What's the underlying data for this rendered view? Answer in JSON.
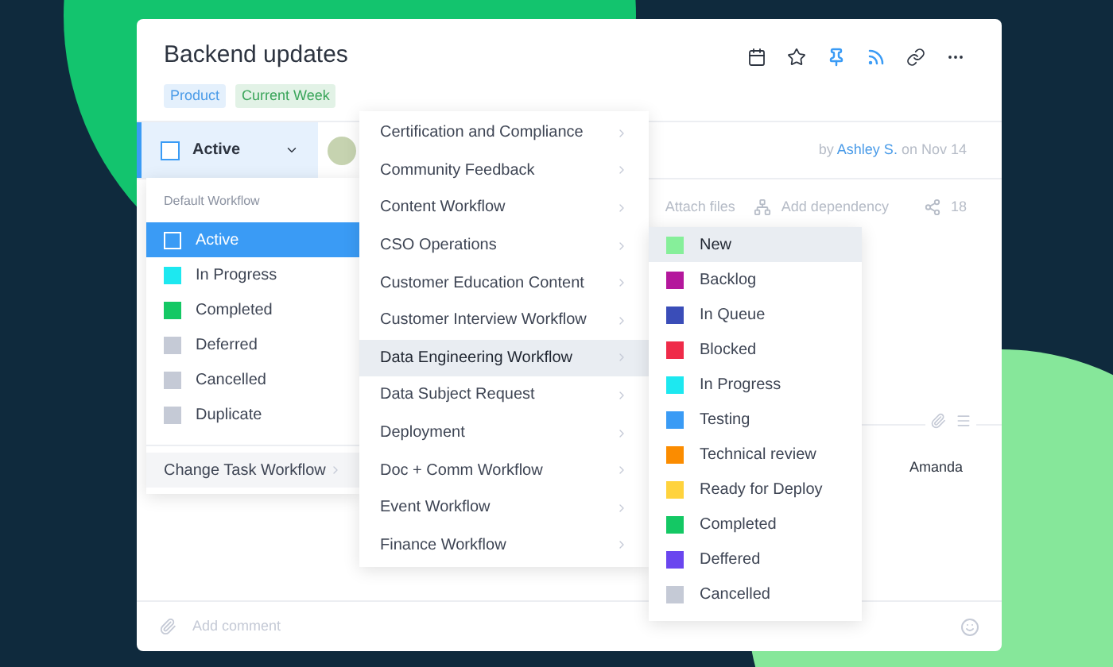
{
  "task": {
    "title": "Backend updates",
    "tags": [
      {
        "label": "Product",
        "color": "#4a9be8"
      },
      {
        "label": "Current Week",
        "color": "#3aa55a"
      }
    ],
    "header_actions": [
      {
        "kind": "calendar",
        "on": false
      },
      {
        "kind": "star",
        "on": false
      },
      {
        "kind": "pin",
        "on": true
      },
      {
        "kind": "rss",
        "on": true
      },
      {
        "kind": "link",
        "on": false
      },
      {
        "kind": "more",
        "on": false
      }
    ],
    "status": "Active",
    "author": {
      "prefix": "by",
      "name": "Ashley S.",
      "suffix": "on Nov 14"
    },
    "toolbar": {
      "attach": "Attach files",
      "dependency": "Add dependency",
      "shares": "18"
    },
    "assignee": "Amanda",
    "comment": {
      "placeholder": "Add comment"
    }
  },
  "status_menu": {
    "header": "Default Workflow",
    "items": [
      {
        "label": "Active",
        "selected": true
      },
      {
        "label": "In Progress",
        "color": "#1de8f0",
        "selected": false
      },
      {
        "label": "Completed",
        "color": "#14c864",
        "selected": false
      },
      {
        "label": "Deferred",
        "color": "#c5cad6",
        "selected": false
      },
      {
        "label": "Cancelled",
        "color": "#c5cad6",
        "selected": false
      },
      {
        "label": "Duplicate",
        "color": "#c5cad6",
        "selected": false
      }
    ],
    "footer": "Change Task Workflow"
  },
  "workflow_menu": {
    "items": [
      {
        "label": "Certification and Compliance",
        "selected": false
      },
      {
        "label": "Community Feedback",
        "selected": false
      },
      {
        "label": "Content Workflow",
        "selected": false
      },
      {
        "label": "CSO Operations",
        "selected": false
      },
      {
        "label": "Customer Education Content",
        "selected": false
      },
      {
        "label": "Customer Interview Workflow",
        "selected": false
      },
      {
        "label": "Data Engineering Workflow",
        "selected": true
      },
      {
        "label": "Data Subject Request",
        "selected": false
      },
      {
        "label": "Deployment",
        "selected": false
      },
      {
        "label": "Doc + Comm Workflow",
        "selected": false
      },
      {
        "label": "Event Workflow",
        "selected": false
      },
      {
        "label": "Finance Workflow",
        "selected": false
      }
    ]
  },
  "status_submenu": {
    "items": [
      {
        "label": "New",
        "color": "#86ef9a",
        "selected": true
      },
      {
        "label": "Backlog",
        "color": "#b4179c",
        "selected": false
      },
      {
        "label": "In Queue",
        "color": "#3a4db8",
        "selected": false
      },
      {
        "label": "Blocked",
        "color": "#ef2b49",
        "selected": false
      },
      {
        "label": "In Progress",
        "color": "#1de8f0",
        "selected": false
      },
      {
        "label": "Testing",
        "color": "#3a9bf5",
        "selected": false
      },
      {
        "label": "Technical review",
        "color": "#fb8c00",
        "selected": false
      },
      {
        "label": "Ready for Deploy",
        "color": "#ffd33d",
        "selected": false
      },
      {
        "label": "Completed",
        "color": "#14c864",
        "selected": false
      },
      {
        "label": "Deffered",
        "color": "#6a46ef",
        "selected": false
      },
      {
        "label": "Cancelled",
        "color": "#c5cad6",
        "selected": false
      }
    ]
  }
}
